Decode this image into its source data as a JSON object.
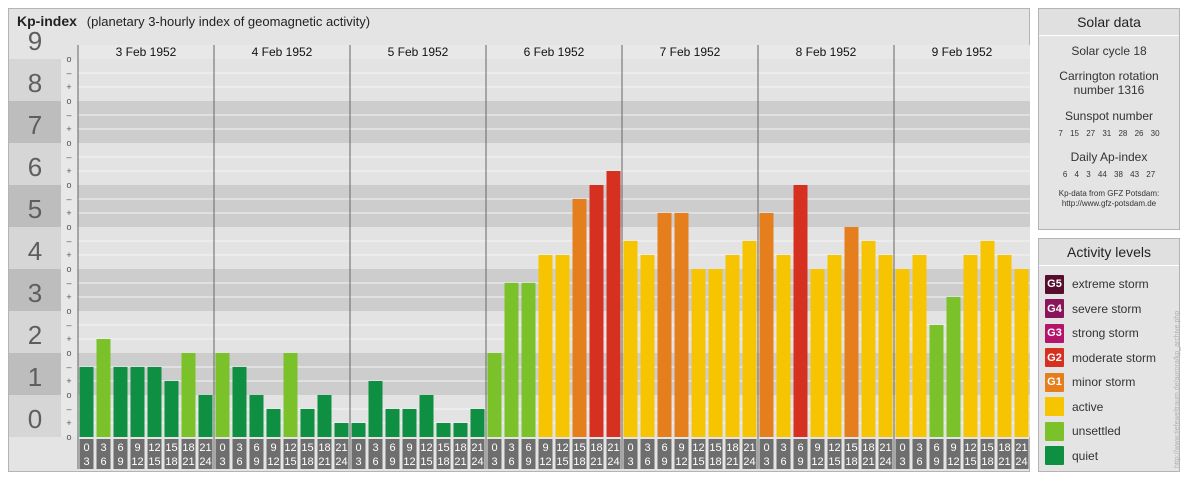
{
  "title": {
    "main": "Kp-index",
    "subtitle": "(planetary 3-hourly index of geomagnetic activity)"
  },
  "colors": {
    "quiet": "#0e8f41",
    "unsettled": "#7ac12a",
    "active": "#f6c400",
    "minor": "#e57e1c",
    "moderate": "#d53020",
    "strong": "#b5146b",
    "severe": "#8a1559",
    "extreme": "#560d2e"
  },
  "chart_data": {
    "type": "bar",
    "y_axis": {
      "ticks": [
        "0",
        "1",
        "2",
        "3",
        "4",
        "5",
        "6",
        "7",
        "8",
        "9"
      ],
      "min": 0,
      "max": 9,
      "sublevels": [
        "–",
        "o",
        "+"
      ]
    },
    "grid": true,
    "interval_labels": [
      [
        "0",
        "3"
      ],
      [
        "3",
        "6"
      ],
      [
        "6",
        "9"
      ],
      [
        "9",
        "12"
      ],
      [
        "12",
        "15"
      ],
      [
        "15",
        "18"
      ],
      [
        "18",
        "21"
      ],
      [
        "21",
        "24"
      ]
    ],
    "days": [
      {
        "date": "3 Feb 1952",
        "kp": [
          1.667,
          2.333,
          1.667,
          1.667,
          1.667,
          1.333,
          2.0,
          1.0
        ]
      },
      {
        "date": "4 Feb 1952",
        "kp": [
          2.0,
          1.667,
          1.0,
          0.667,
          2.0,
          0.667,
          1.0,
          0.333
        ]
      },
      {
        "date": "5 Feb 1952",
        "kp": [
          0.333,
          1.333,
          0.667,
          0.667,
          1.0,
          0.333,
          0.333,
          0.667
        ]
      },
      {
        "date": "6 Feb 1952",
        "kp": [
          2.0,
          3.667,
          3.667,
          4.333,
          4.333,
          5.667,
          6.0,
          6.333
        ]
      },
      {
        "date": "7 Feb 1952",
        "kp": [
          4.667,
          4.333,
          5.333,
          5.333,
          4.0,
          4.0,
          4.333,
          4.667
        ]
      },
      {
        "date": "8 Feb 1952",
        "kp": [
          5.333,
          4.333,
          6.0,
          4.0,
          4.333,
          5.0,
          4.667,
          4.333
        ]
      },
      {
        "date": "9 Feb 1952",
        "kp": [
          4.0,
          4.333,
          2.667,
          3.333,
          4.333,
          4.667,
          4.333,
          4.0
        ]
      }
    ]
  },
  "solar": {
    "heading": "Solar data",
    "cycle": "Solar cycle 18",
    "carrington_line1": "Carrington rotation",
    "carrington_line2": "number 1316",
    "sunspot_label": "Sunspot number",
    "sunspot_values": "7 15 27 31 28 26 30",
    "ap_label": "Daily Ap-index",
    "ap_values": "6 4 3 44 38 43 27",
    "source_line1": "Kp-data from GFZ Potsdam:",
    "source_line2": "http://www.gfz-potsdam.de"
  },
  "activity": {
    "heading": "Activity levels",
    "levels": [
      {
        "code": "G5",
        "label": "extreme storm",
        "color": "#560d2e"
      },
      {
        "code": "G4",
        "label": "severe storm",
        "color": "#8a1559"
      },
      {
        "code": "G3",
        "label": "strong storm",
        "color": "#b5146b"
      },
      {
        "code": "G2",
        "label": "moderate storm",
        "color": "#d53020"
      },
      {
        "code": "G1",
        "label": "minor storm",
        "color": "#e57e1c"
      },
      {
        "code": "",
        "label": "active",
        "color": "#f6c400"
      },
      {
        "code": "",
        "label": "unsettled",
        "color": "#7ac12a"
      },
      {
        "code": "",
        "label": "quiet",
        "color": "#0e8f41"
      }
    ]
  },
  "watermark": "http://www.tiefeweltraum.de/aurora/kp_archive.php"
}
